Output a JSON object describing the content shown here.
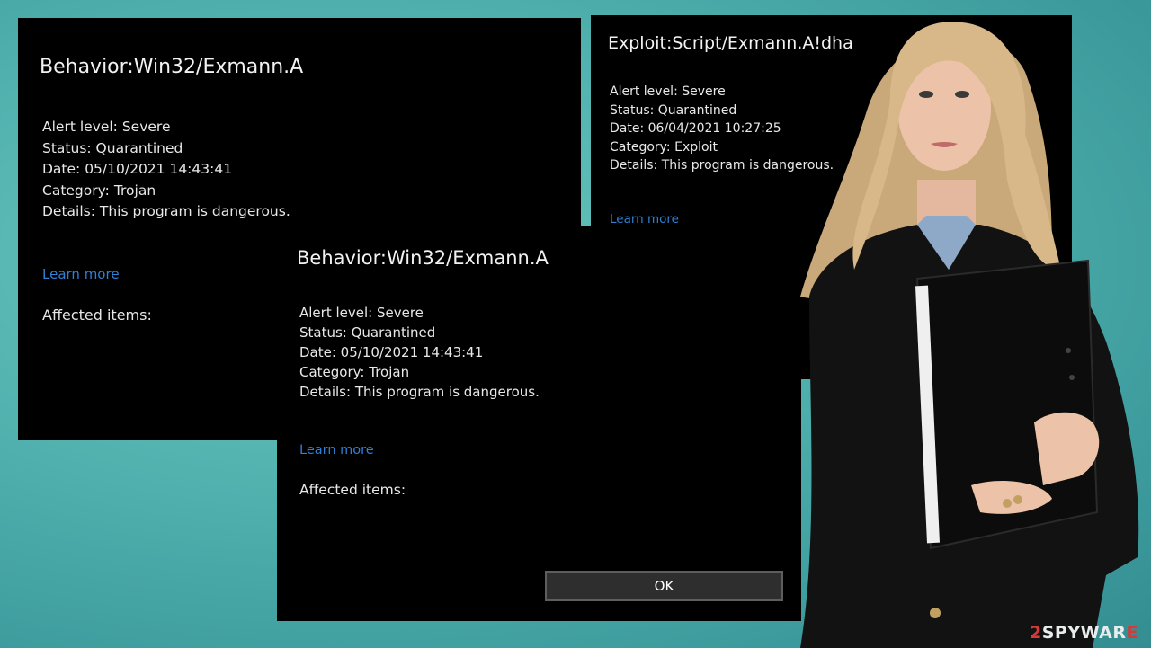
{
  "dialog_1": {
    "title": "Behavior:Win32/Exmann.A",
    "alert_level": "Alert level: Severe",
    "status": "Status: Quarantined",
    "date": "Date:  05/10/2021 14:43:41",
    "category": "Category:  Trojan",
    "details": "Details:  This program is dangerous.",
    "learn_more": "Learn more",
    "affected_items": "Affected items:"
  },
  "dialog_2": {
    "title": "Exploit:Script/Exmann.A!dha",
    "alert_level": "Alert level: Severe",
    "status": "Status: Quarantined",
    "date": "Date:  06/04/2021 10:27:25",
    "category": "Category:  Exploit",
    "details": "Details:  This program is dangerous.",
    "learn_more": "Learn more"
  },
  "dialog_3": {
    "title": "Behavior:Win32/Exmann.A",
    "alert_level": "Alert level: Severe",
    "status": "Status: Quarantined",
    "date": "Date:  05/10/2021 14:43:41",
    "category": "Category:  Trojan",
    "details": "Details:  This program is dangerous.",
    "learn_more": "Learn more",
    "affected_items": "Affected items:",
    "ok_label": "OK"
  },
  "watermark": {
    "prefix": "2",
    "brand": "SPYWAR",
    "suffix": "E"
  },
  "colors": {
    "background": "#4fb0ad",
    "dialog_bg": "#000000",
    "link": "#2f7fd4",
    "watermark_accent": "#d43a3a"
  }
}
